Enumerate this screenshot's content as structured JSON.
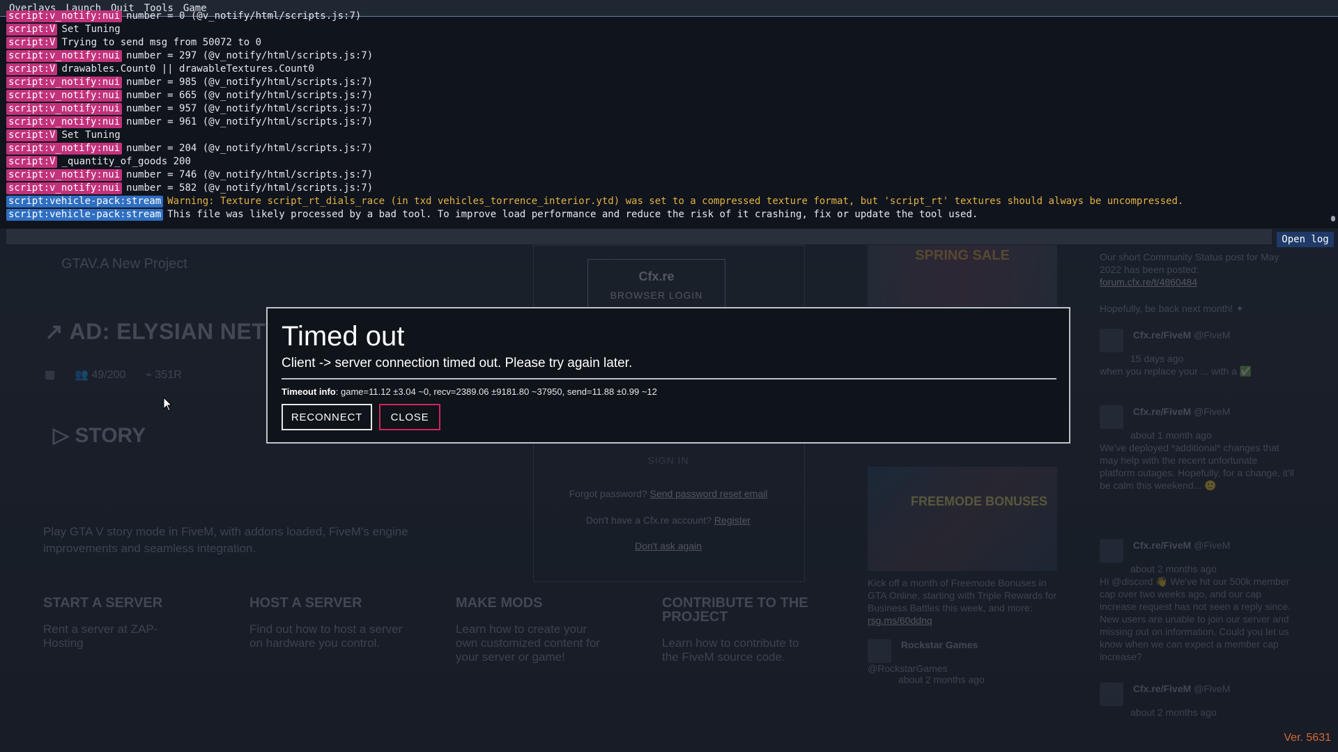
{
  "menu": [
    "Overlays",
    "Launch",
    "Quit",
    "Tools",
    "Game"
  ],
  "console": {
    "lines": [
      {
        "tag": "script:v_notify:nui",
        "color": "pink",
        "text": "number = 0 (@v_notify/html/scripts.js:7)"
      },
      {
        "tag": "script:V",
        "color": "pink",
        "text": "Set Tuning"
      },
      {
        "tag": "script:V",
        "color": "pink",
        "text": "Trying to send msg from 50072 to 0"
      },
      {
        "tag": "script:v_notify:nui",
        "color": "pink",
        "text": "number = 297 (@v_notify/html/scripts.js:7)"
      },
      {
        "tag": "script:V",
        "color": "pink",
        "text": "drawables.Count0 || drawableTextures.Count0"
      },
      {
        "tag": "script:v_notify:nui",
        "color": "pink",
        "text": "number = 985 (@v_notify/html/scripts.js:7)"
      },
      {
        "tag": "script:v_notify:nui",
        "color": "pink",
        "text": "number = 665 (@v_notify/html/scripts.js:7)"
      },
      {
        "tag": "script:v_notify:nui",
        "color": "pink",
        "text": "number = 957 (@v_notify/html/scripts.js:7)"
      },
      {
        "tag": "script:v_notify:nui",
        "color": "pink",
        "text": "number = 961 (@v_notify/html/scripts.js:7)"
      },
      {
        "tag": "script:V",
        "color": "pink",
        "text": "Set Tuning"
      },
      {
        "tag": "script:v_notify:nui",
        "color": "pink",
        "text": "number = 204 (@v_notify/html/scripts.js:7)"
      },
      {
        "tag": "script:V",
        "color": "pink",
        "text": "_quantity_of_goods 200"
      },
      {
        "tag": "script:v_notify:nui",
        "color": "pink",
        "text": "number = 746 (@v_notify/html/scripts.js:7)"
      },
      {
        "tag": "script:v_notify:nui",
        "color": "pink",
        "text": "number = 582 (@v_notify/html/scripts.js:7)"
      },
      {
        "tag": "script:vehicle-pack:stream",
        "color": "blue",
        "warn": true,
        "text": "Warning: Texture script_rt_dials_race (in txd vehicles_torrence_interior.ytd) was set to a compressed texture format, but 'script_rt' textures should always be uncompressed."
      },
      {
        "tag": "script:vehicle-pack:stream",
        "color": "blue",
        "text": "This file was likely processed by a bad tool. To improve load performance and reduce the risk of it crashing, fix or update the tool used."
      }
    ],
    "input_value": "",
    "open_log_label": "Open log"
  },
  "dialog": {
    "title": "Timed out",
    "message": "Client -> server connection timed out. Please try again later.",
    "info_label": "Timeout info",
    "info_text": ": game=11.12 ±3.04 ~0, recv=2389.06 ±9181.80 ~37950, send=11.88 ±0.99 ~12",
    "reconnect_label": "RECONNECT",
    "close_label": "CLOSE"
  },
  "background": {
    "project_title": "GTAV.A New Project",
    "project_subtitle": "",
    "ad_title": "AD: ELYSIAN NETW",
    "ad_players": "49/200",
    "ad_ping": "351R",
    "story_label": "STORY",
    "story_desc": "Play GTA V story mode in FiveM, with addons loaded, FiveM's engine improvements and seamless integration.",
    "tiles": [
      {
        "title": "START A SERVER",
        "text": "Rent a server at ZAP-Hosting"
      },
      {
        "title": "HOST A SERVER",
        "text": "Find out how to host a server on hardware you control."
      },
      {
        "title": "MAKE MODS",
        "text": "Learn how to create your own customized content for your server or game!"
      },
      {
        "title": "CONTRIBUTE TO THE PROJECT",
        "text": "Learn how to contribute to the FiveM source code."
      }
    ],
    "login": {
      "brand": "Cfx.re",
      "browser_login": "BROWSER LOGIN",
      "sign_in": "SIGN IN",
      "forgot_prefix": "Forgot password?",
      "forgot_link": "Send password reset email",
      "noacct_prefix": "Don't have a Cfx.re account?",
      "register_link": "Register",
      "dont_ask": "Don't ask again"
    },
    "news": {
      "promo_label": "SPRING SALE",
      "freemode_label": "FREEMODE BONUSES",
      "text": "Kick off a month of Freemode Bonuses in GTA Online, starting with Triple Rewards for Business Battles this week, and more:",
      "link": "rsg.ms/60ddnq",
      "rockstar_name": "Rockstar Games",
      "rockstar_handle": "@RockstarGames",
      "rockstar_time": "about 2 months ago"
    },
    "feed": [
      {
        "text": "Our short Community Status post for May 2022 has been posted:",
        "link": "forum.cfx.re/t/4860484"
      },
      {
        "text": "Hopefully, be back next month! ✦"
      },
      {
        "author": "Cfx.re/FiveM",
        "handle": "@FiveM",
        "time": "15 days ago",
        "text": "when you replace your ... with a ✅"
      },
      {
        "author": "Cfx.re/FiveM",
        "handle": "@FiveM",
        "time": "about 1 month ago",
        "text": "We've deployed *additional* changes that may help with the recent unfortunate platform outages. Hopefully, for a change, it'll be calm this weekend... 🙂"
      },
      {
        "author": "Cfx.re/FiveM",
        "handle": "@FiveM",
        "time": "about 2 months ago",
        "text": "Hi @discord 👋 We've hit our 500k member cap over two weeks ago, and our cap increase request has not seen a reply since. New users are unable to join our server and missing out on information. Could you let us know when we can expect a member cap increase?"
      },
      {
        "author": "Cfx.re/FiveM",
        "handle": "@FiveM",
        "time": "about 2 months ago",
        "text": ""
      }
    ],
    "version": "Ver. 5631"
  },
  "colors": {
    "tag_pink": "#c2327c",
    "tag_blue": "#2f6fc2",
    "warning": "#e4b245",
    "close_border": "#d0245f",
    "version": "#d56a3a"
  }
}
